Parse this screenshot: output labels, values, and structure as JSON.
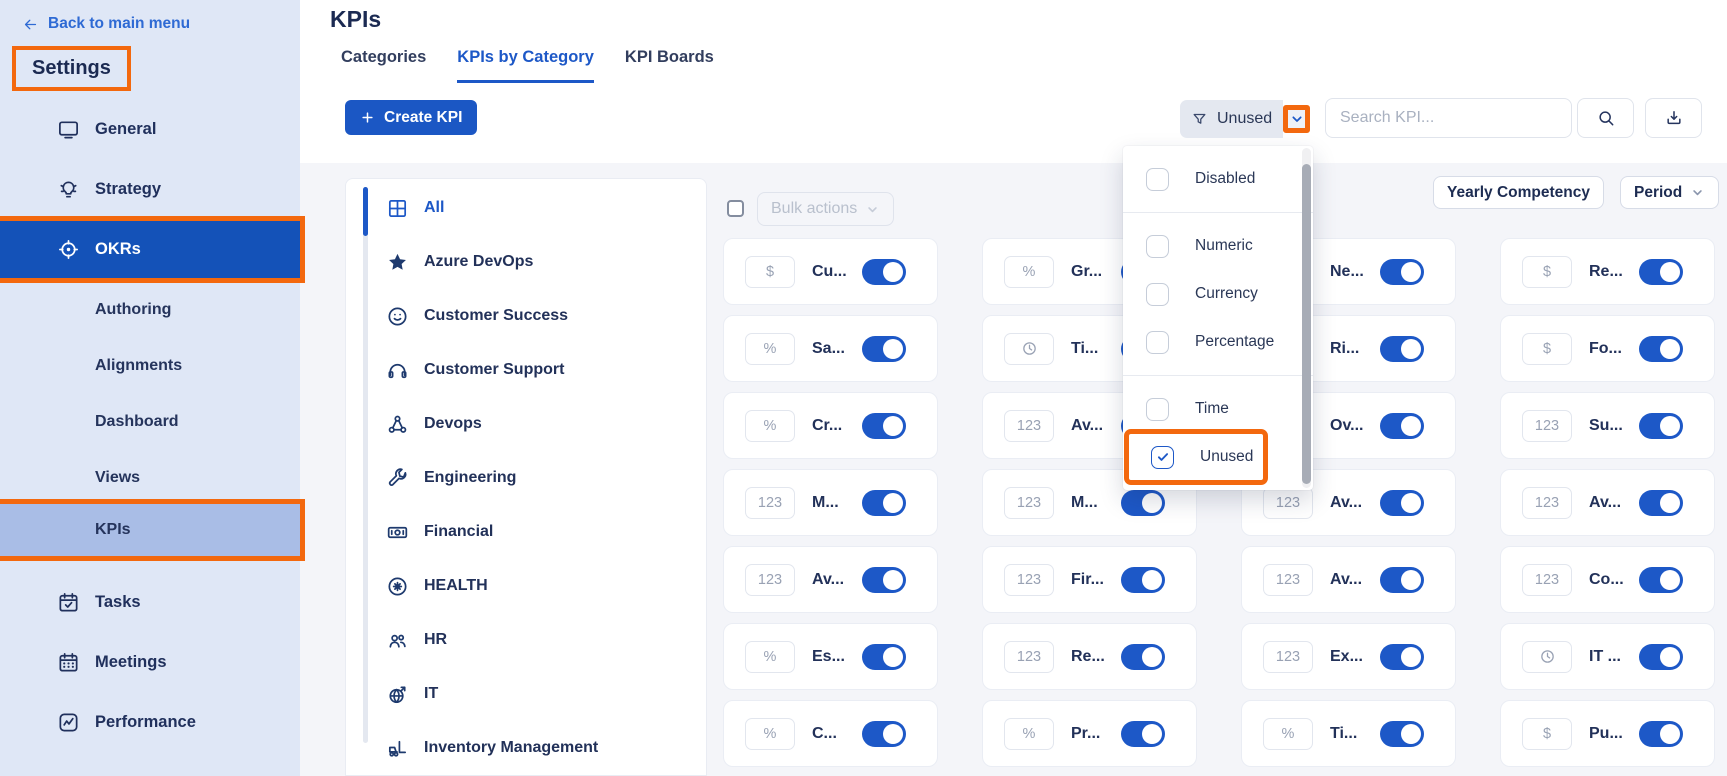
{
  "colors": {
    "accent": "#1d58c7",
    "annotation-orange": "#f3680e",
    "sidebar-bg": "#dfe7f6",
    "active-row-blue": "#1452b8",
    "active-sub-bg": "#a9bde6",
    "content-bg": "#f4f5f9"
  },
  "sidebar": {
    "back": {
      "icon": "arrow-left",
      "label": "Back to main menu"
    },
    "title": "Settings",
    "items": [
      {
        "label": "General",
        "icon": "monitor",
        "active": false,
        "annotated": false
      },
      {
        "label": "Strategy",
        "icon": "lightbulb",
        "active": false,
        "annotated": false
      },
      {
        "label": "OKRs",
        "icon": "target",
        "active": true,
        "annotated": true,
        "children": [
          {
            "label": "Authoring",
            "active": false,
            "annotated": false
          },
          {
            "label": "Alignments",
            "active": false,
            "annotated": false
          },
          {
            "label": "Dashboard",
            "active": false,
            "annotated": false
          },
          {
            "label": "Views",
            "active": false,
            "annotated": false
          },
          {
            "label": "KPIs",
            "active": true,
            "annotated": true
          }
        ]
      },
      {
        "label": "Tasks",
        "icon": "calendar-check",
        "active": false,
        "annotated": false
      },
      {
        "label": "Meetings",
        "icon": "calendar",
        "active": false,
        "annotated": false
      },
      {
        "label": "Performance",
        "icon": "chart-line",
        "active": false,
        "annotated": false
      }
    ]
  },
  "header": {
    "title": "KPIs",
    "tabs": [
      {
        "label": "Categories",
        "active": false
      },
      {
        "label": "KPIs by Category",
        "active": true
      },
      {
        "label": "KPI Boards",
        "active": false
      }
    ]
  },
  "toolbar": {
    "create_label": "Create KPI",
    "filter": {
      "icon": "funnel",
      "label": "Unused",
      "chevron_annotated": true
    },
    "search_placeholder": "Search KPI...",
    "search_icon": "magnifier",
    "export_icon": "download"
  },
  "filter_menu": {
    "groups": [
      [
        {
          "label": "Disabled",
          "checked": false,
          "annotated": false
        }
      ],
      [
        {
          "label": "Numeric",
          "checked": false,
          "annotated": false
        },
        {
          "label": "Currency",
          "checked": false,
          "annotated": false
        },
        {
          "label": "Percentage",
          "checked": false,
          "annotated": false
        }
      ],
      [
        {
          "label": "Time",
          "checked": false,
          "annotated": false
        },
        {
          "label": "Unused",
          "checked": true,
          "annotated": true
        }
      ]
    ]
  },
  "categories": [
    {
      "label": "All",
      "icon": "grid",
      "active": true
    },
    {
      "label": "Azure DevOps",
      "icon": "star",
      "active": false
    },
    {
      "label": "Customer Success",
      "icon": "smiley",
      "active": false
    },
    {
      "label": "Customer Support",
      "icon": "headphones",
      "active": false
    },
    {
      "label": "Devops",
      "icon": "share-nodes",
      "active": false
    },
    {
      "label": "Engineering",
      "icon": "wrench",
      "active": false
    },
    {
      "label": "Financial",
      "icon": "money-bill",
      "active": false
    },
    {
      "label": "HEALTH",
      "icon": "health-cross",
      "active": false
    },
    {
      "label": "HR",
      "icon": "people",
      "active": false
    },
    {
      "label": "IT",
      "icon": "globe",
      "active": false
    },
    {
      "label": "Inventory Management",
      "icon": "forklift",
      "active": false
    }
  ],
  "list_controls": {
    "bulk_label": "Bulk actions",
    "yearly_label": "Yearly Competency",
    "period_label": "Period"
  },
  "kpi_grid": {
    "columns": [
      [
        {
          "type": "currency",
          "name": "Cu...",
          "enabled": true
        },
        {
          "type": "percentage",
          "name": "Sa...",
          "enabled": true
        },
        {
          "type": "percentage",
          "name": "Cr...",
          "enabled": true
        },
        {
          "type": "numeric",
          "name": "M...",
          "enabled": true
        },
        {
          "type": "numeric",
          "name": "Av...",
          "enabled": true
        },
        {
          "type": "percentage",
          "name": "Es...",
          "enabled": true
        },
        {
          "type": "percentage",
          "name": "C...",
          "enabled": true
        }
      ],
      [
        {
          "type": "percentage",
          "name": "Gr...",
          "enabled": true
        },
        {
          "type": "time",
          "name": "Ti...",
          "enabled": true
        },
        {
          "type": "numeric",
          "name": "Av...",
          "enabled": true
        },
        {
          "type": "numeric",
          "name": "M...",
          "enabled": true
        },
        {
          "type": "numeric",
          "name": "Fir...",
          "enabled": true
        },
        {
          "type": "numeric",
          "name": "Re...",
          "enabled": true
        },
        {
          "type": "percentage",
          "name": "Pr...",
          "enabled": true
        }
      ],
      [
        {
          "type": null,
          "name": "Ne...",
          "enabled": true
        },
        {
          "type": null,
          "name": "Ri...",
          "enabled": true
        },
        {
          "type": null,
          "name": "Ov...",
          "enabled": true
        },
        {
          "type": "numeric",
          "name": "Av...",
          "enabled": true
        },
        {
          "type": "numeric",
          "name": "Av...",
          "enabled": true
        },
        {
          "type": "numeric",
          "name": "Ex...",
          "enabled": true
        },
        {
          "type": "percentage",
          "name": "Ti...",
          "enabled": true
        }
      ],
      [
        {
          "type": "currency",
          "name": "Re...",
          "enabled": true
        },
        {
          "type": "currency",
          "name": "Fo...",
          "enabled": true
        },
        {
          "type": "numeric",
          "name": "Su...",
          "enabled": true
        },
        {
          "type": "numeric",
          "name": "Av...",
          "enabled": true
        },
        {
          "type": "numeric",
          "name": "Co...",
          "enabled": true
        },
        {
          "type": "time",
          "name": "IT ...",
          "enabled": true
        },
        {
          "type": "currency",
          "name": "Pu...",
          "enabled": true
        }
      ]
    ]
  }
}
